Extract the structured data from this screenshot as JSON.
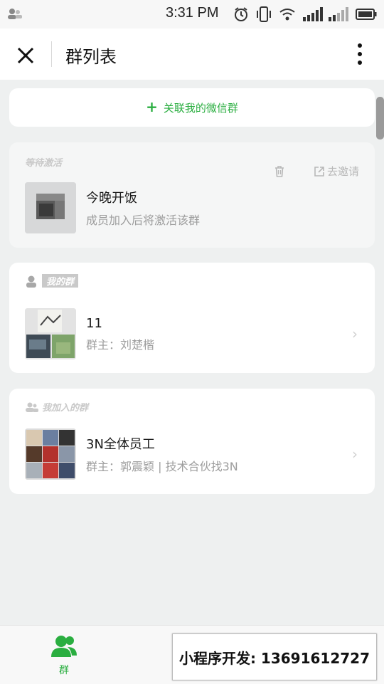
{
  "status_bar": {
    "time": "3:31 PM"
  },
  "nav": {
    "title": "群列表"
  },
  "link_button": {
    "label": "关联我的微信群"
  },
  "pending_section": {
    "title": "等待激活",
    "group": {
      "name": "今晚开饭",
      "subtitle": "成员加入后将激活该群",
      "invite_label": "去邀请"
    }
  },
  "my_groups": {
    "title": "我的群",
    "group": {
      "name": "11",
      "owner": "群主：刘楚楷"
    }
  },
  "joined_groups": {
    "title": "我加入的群",
    "group": {
      "name": "3N全体员工",
      "owner": "群主：郭震颖 | 技术合伙找3N"
    }
  },
  "tab_bar": {
    "tab_label": "群"
  },
  "promo": {
    "text": "小程序开发: 13691612727"
  },
  "colors": {
    "accent": "#2aae40",
    "background": "#eef0f0",
    "card": "#ffffff"
  },
  "icons": [
    "user-status-icon",
    "alarm-icon",
    "vibrate-icon",
    "wifi-icon",
    "signal-icon",
    "battery-icon",
    "close-icon",
    "more-icon",
    "plus-icon",
    "trash-icon",
    "share-icon",
    "chevron-right-icon",
    "group-tab-icon"
  ]
}
